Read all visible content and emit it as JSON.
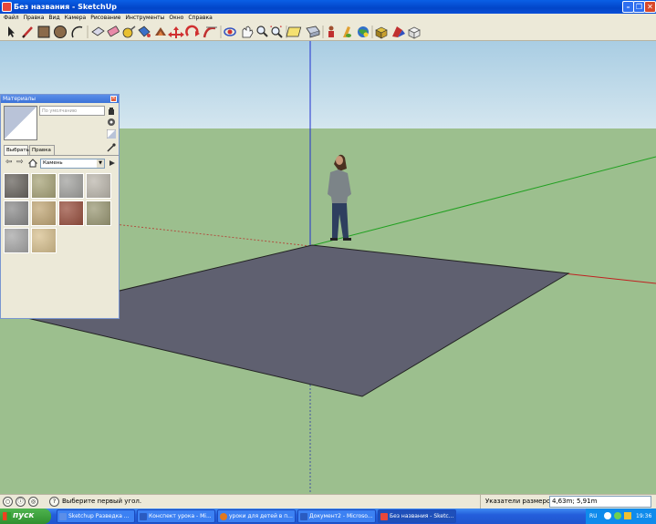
{
  "window": {
    "title": "Без названия - SketchUp"
  },
  "menu": [
    "Файл",
    "Правка",
    "Вид",
    "Камера",
    "Рисование",
    "Инструменты",
    "Окно",
    "Справка"
  ],
  "toolbar": {
    "icons": [
      "select-icon",
      "pencil-icon",
      "rectangle-icon",
      "circle-icon",
      "arc-icon",
      "push-pull-icon",
      "eraser-icon",
      "tape-measure-icon",
      "paint-bucket-icon",
      "offset-icon",
      "move-icon",
      "rotate-icon",
      "follow-me-icon",
      "orbit-icon",
      "pan-icon",
      "zoom-icon",
      "zoom-extents-icon",
      "section-icon",
      "model-icon",
      "person-icon",
      "footprint-icon",
      "globe-icon",
      "components-icon",
      "materials-icon",
      "styles-icon"
    ]
  },
  "materials_panel": {
    "title": "Материалы",
    "name_field": "По умолчанию",
    "tabs": [
      "Выбрать",
      "Правка"
    ],
    "category": "Камень",
    "swatch_colors": [
      "#6a6660",
      "#a9a57a",
      "#a3a3a0",
      "#bdb8ae",
      "#8c8c8c",
      "#c2a877",
      "#9a5140",
      "#9c9a76",
      "#a8a8a8",
      "#d8c190"
    ]
  },
  "status": {
    "hint": "Выберите первый угол.",
    "measure_label": "Указатели размеров",
    "measure_value": "4,63m; 5,91m"
  },
  "taskbar": {
    "start": "пуск",
    "tasks": [
      "Sketchup Разведка ...",
      "Конспект урока - Mi...",
      "уроки для детей в п...",
      "Документ2 - Microso...",
      "Без названия - Sketc..."
    ],
    "tray_lang": "RU",
    "clock": "19:36"
  }
}
